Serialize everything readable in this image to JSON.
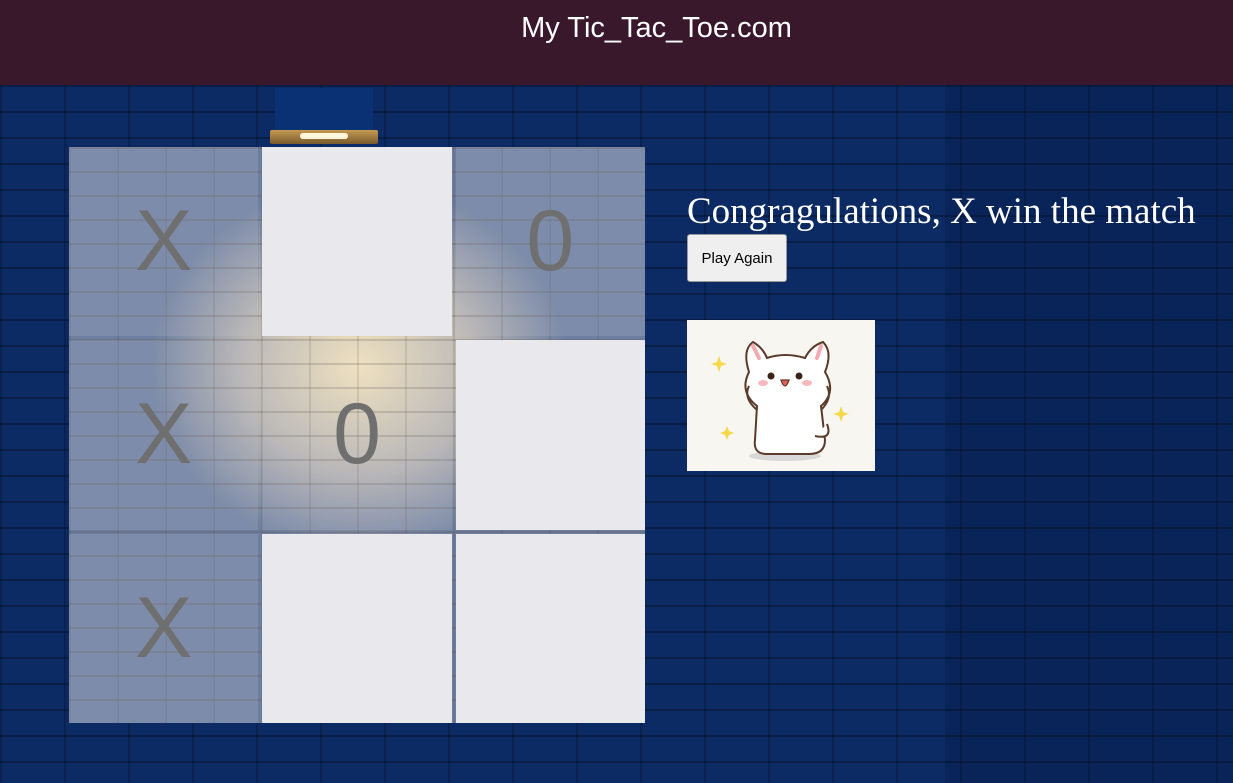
{
  "header": {
    "title": "My Tic_Tac_Toe.com"
  },
  "board": {
    "cells": [
      {
        "value": "X",
        "state": "filled"
      },
      {
        "value": "",
        "state": "empty"
      },
      {
        "value": "0",
        "state": "filled"
      },
      {
        "value": "X",
        "state": "filled"
      },
      {
        "value": "0",
        "state": "filled"
      },
      {
        "value": "",
        "state": "empty"
      },
      {
        "value": "X",
        "state": "filled"
      },
      {
        "value": "",
        "state": "empty"
      },
      {
        "value": "",
        "state": "empty"
      }
    ]
  },
  "result": {
    "message": "Congragulations, X win the match",
    "play_again_label": "Play Again"
  },
  "colors": {
    "header_bg": "#3a182b",
    "wall": "#0c2a63",
    "empty_cell": "#e9e8ec",
    "mark": "#6f6f6f"
  },
  "icons": {
    "celebration": "cat-celebration-icon"
  }
}
